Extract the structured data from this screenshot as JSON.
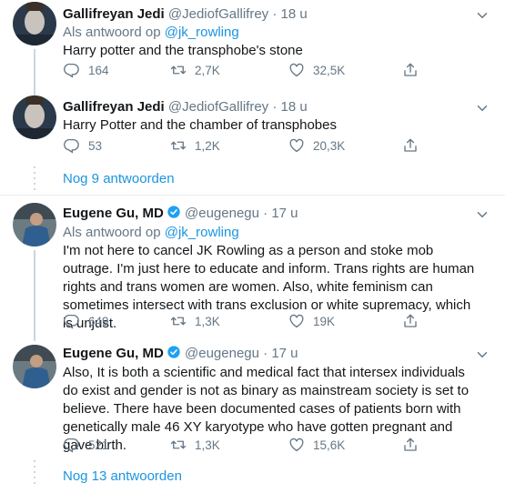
{
  "tweets": [
    {
      "name": "Gallifreyan Jedi",
      "handle": "@JediofGallifrey",
      "dot": "·",
      "time": "18 u",
      "reply_prefix": "Als antwoord op",
      "reply_handle": "@jk_rowling",
      "text": "Harry potter and the transphobe's stone",
      "replies": "164",
      "retweets": "2,7K",
      "likes": "32,5K"
    },
    {
      "name": "Gallifreyan Jedi",
      "handle": "@JediofGallifrey",
      "dot": "·",
      "time": "18 u",
      "text": "Harry Potter and the chamber of transphobes",
      "replies": "53",
      "retweets": "1,2K",
      "likes": "20,3K"
    },
    {
      "name": "Eugene Gu, MD",
      "handle": "@eugenegu",
      "dot": "·",
      "time": "17 u",
      "reply_prefix": "Als antwoord op",
      "reply_handle": "@jk_rowling",
      "text": "I'm not here to cancel JK Rowling as a person and stoke mob outrage. I'm just here to educate and inform. Trans rights are human rights and trans women are women. Also, white feminism can sometimes intersect with trans exclusion or white supremacy, which is unjust.",
      "replies": "649",
      "retweets": "1,3K",
      "likes": "19K"
    },
    {
      "name": "Eugene Gu, MD",
      "handle": "@eugenegu",
      "dot": "·",
      "time": "17 u",
      "text": "Also, It is both a scientific and medical fact that intersex individuals do exist and gender is not as binary as mainstream society is set to believe. There have been documented cases of patients born with genetically male 46 XY karyotype who have gotten pregnant and gave birth.",
      "replies": "521",
      "retweets": "1,3K",
      "likes": "15,6K"
    }
  ],
  "more_replies_1": "Nog 9 antwoorden",
  "more_replies_2": "Nog 13 antwoorden",
  "colors": {
    "accent": "#1b95e0",
    "muted": "#657786",
    "text": "#14171a",
    "border": "#e6ecf0"
  },
  "icons": [
    "reply-icon",
    "retweet-icon",
    "like-icon",
    "share-icon",
    "caret-down-icon",
    "verified-icon"
  ]
}
